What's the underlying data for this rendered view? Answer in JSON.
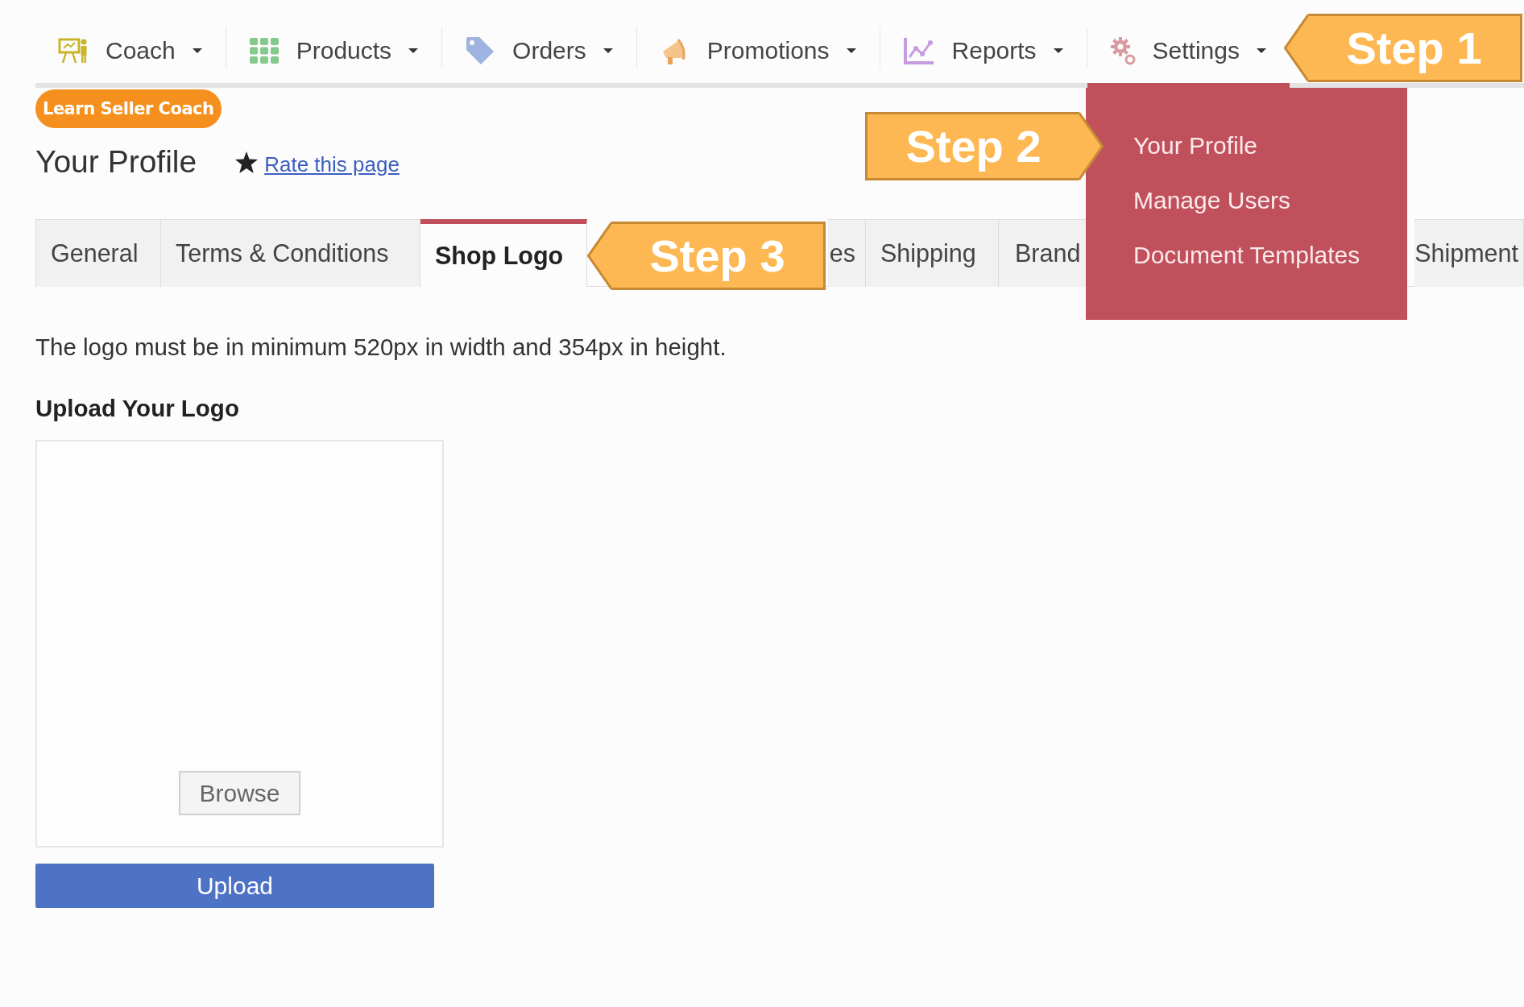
{
  "nav": {
    "items": [
      {
        "label": "Coach",
        "selected": false
      },
      {
        "label": "Products",
        "selected": false
      },
      {
        "label": "Orders",
        "selected": false
      },
      {
        "label": "Promotions",
        "selected": false
      },
      {
        "label": "Reports",
        "selected": false
      },
      {
        "label": "Settings",
        "selected": true
      }
    ]
  },
  "badge": "Learn Seller Coach",
  "page_title": "Your Profile",
  "rate_link": "Rate this page",
  "tabs": [
    {
      "label": "General",
      "selected": false
    },
    {
      "label": "Terms & Conditions",
      "selected": false
    },
    {
      "label": "Shop Logo",
      "selected": true
    },
    {
      "label": "es",
      "selected": false
    },
    {
      "label": "Shipping",
      "selected": false
    },
    {
      "label": "Brand",
      "selected": false
    },
    {
      "label": "Shipment",
      "selected": false
    }
  ],
  "description": "The logo must be in minimum 520px in width and 354px in height.",
  "upload": {
    "title": "Upload Your Logo",
    "browse_button": "Browse",
    "upload_button": "Upload"
  },
  "dropdown": {
    "items": [
      "Your Profile",
      "Manage Users",
      "Document Templates"
    ]
  },
  "callouts": [
    {
      "text": "Step 1",
      "kind": "left"
    },
    {
      "text": "Step 2",
      "kind": "right"
    },
    {
      "text": "Step 3",
      "kind": "left"
    }
  ]
}
